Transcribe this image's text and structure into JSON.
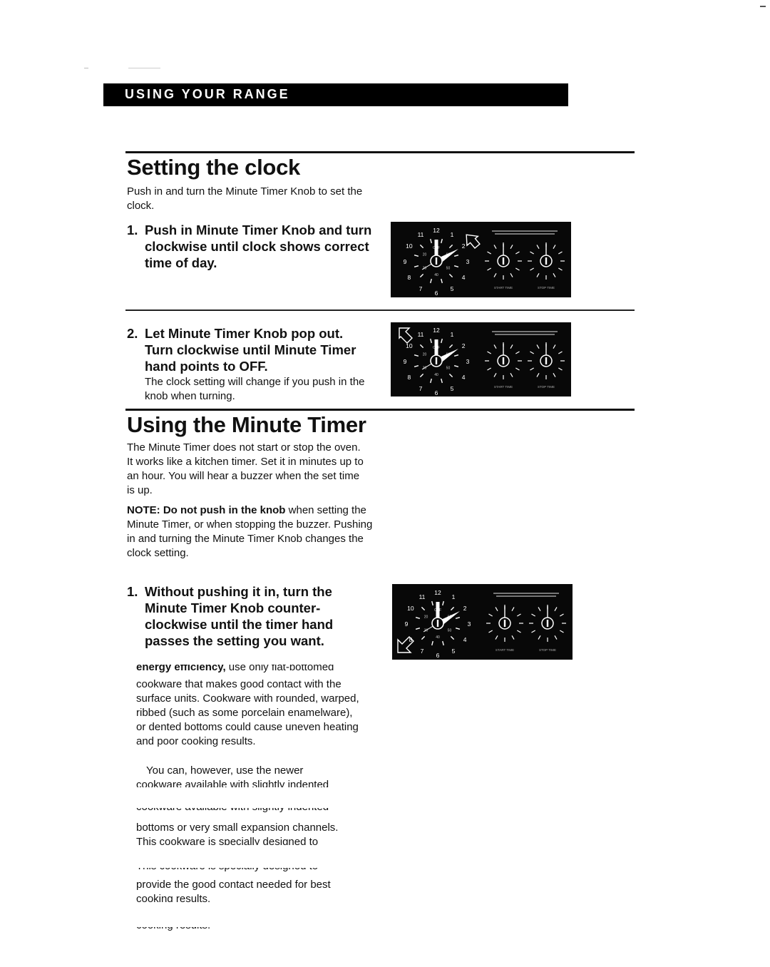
{
  "header": {
    "banner": "USING YOUR RANGE"
  },
  "setting_clock": {
    "title": "Setting the clock",
    "intro": "Push in and turn the Minute Timer Knob to set the clock.",
    "steps": [
      {
        "num": "1.",
        "text": "Push in Minute Timer Knob and turn clockwise until clock shows correct time of day."
      },
      {
        "num": "2.",
        "text": "Let Minute Timer Knob pop out. Turn clockwise until Minute Timer hand points to OFF.",
        "note": "The clock setting will change if you push in the knob when turning."
      }
    ]
  },
  "minute_timer": {
    "title": "Using the Minute Timer",
    "intro": "The Minute Timer does not start or stop the oven. It works like a kitchen timer. Set it in minutes up to an hour. You will hear a buzzer when the set time is up.",
    "note_bold": "NOTE: Do not push in the knob",
    "note_rest": " when setting the Minute Timer, or when stopping the buzzer. Pushing in and turning the Minute Timer Knob changes the clock setting.",
    "steps": [
      {
        "num": "1.",
        "text": "Without pushing it in, turn the Minute Timer Knob counter-clockwise until the timer hand passes the setting you want."
      }
    ]
  },
  "cookware": {
    "line1_bold": "energy efficiency,",
    "line1_rest": " use only flat-bottomed",
    "para1_rest": "cookware that makes good contact with the surface units. Cookware with rounded, warped, ribbed (such as some porcelain enamelware), or dented bottoms could cause uneven heating and poor cooking results.",
    "para2_a": "You can, however, use the newer",
    "para2_b": "cookware available with slightly indented",
    "para2_c": "bottoms or very small expansion channels.",
    "para2_d": "This cookware is specially designed to",
    "para2_e": "provide the good contact needed for best",
    "para2_f": "cooking results."
  },
  "control_panel": {
    "clock_numbers": [
      "12",
      "1",
      "2",
      "3",
      "4",
      "5",
      "6",
      "7",
      "8",
      "9",
      "10",
      "11"
    ],
    "timer_numbers": [
      "OFF",
      "60",
      "50",
      "40",
      "30",
      "20",
      "10"
    ],
    "left_knob_label": "START TIME",
    "right_knob_label": "STOP TIME",
    "panels": [
      {
        "arrow": "clockwise-arrow-right",
        "clock_hour": 2
      },
      {
        "arrow": "pop-out-arrow-up-left",
        "clock_hour": 2
      },
      {
        "arrow": "counterclockwise-arrow-down-left",
        "clock_hour": 2
      }
    ]
  }
}
